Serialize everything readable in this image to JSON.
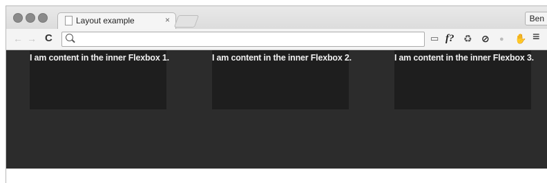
{
  "tab": {
    "title": "Layout example",
    "close": "×"
  },
  "profile": {
    "name": "Ben"
  },
  "toolbar": {
    "back": "←",
    "forward": "→",
    "reload": "C",
    "omnibox_value": ""
  },
  "extensions": [
    {
      "name": "page-icon",
      "glyph": "▭"
    },
    {
      "name": "font-icon",
      "glyph": "f?"
    },
    {
      "name": "recycle-icon",
      "glyph": "♻"
    },
    {
      "name": "blocker-icon",
      "glyph": "⊘"
    },
    {
      "name": "android-icon",
      "glyph": "●"
    },
    {
      "name": "hand-icon",
      "glyph": "✋"
    },
    {
      "name": "menu-icon",
      "glyph": "≡"
    }
  ],
  "content": {
    "boxes": [
      "I am content in the inner Flexbox 1.",
      "I am content in the inner Flexbox 2.",
      "I am content in the inner Flexbox 3."
    ]
  }
}
